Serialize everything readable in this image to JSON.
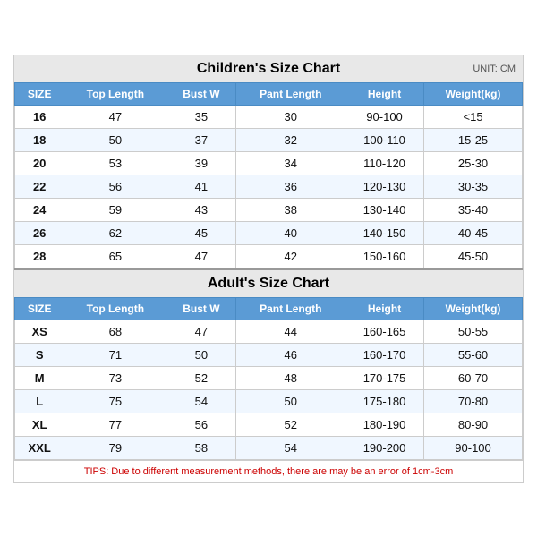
{
  "children_title": "Children's Size Chart",
  "adult_title": "Adult's Size Chart",
  "unit_label": "UNIT: CM",
  "columns": [
    "SIZE",
    "Top Length",
    "Bust W",
    "Pant Length",
    "Height",
    "Weight(kg)"
  ],
  "children_rows": [
    [
      "16",
      "47",
      "35",
      "30",
      "90-100",
      "<15"
    ],
    [
      "18",
      "50",
      "37",
      "32",
      "100-110",
      "15-25"
    ],
    [
      "20",
      "53",
      "39",
      "34",
      "110-120",
      "25-30"
    ],
    [
      "22",
      "56",
      "41",
      "36",
      "120-130",
      "30-35"
    ],
    [
      "24",
      "59",
      "43",
      "38",
      "130-140",
      "35-40"
    ],
    [
      "26",
      "62",
      "45",
      "40",
      "140-150",
      "40-45"
    ],
    [
      "28",
      "65",
      "47",
      "42",
      "150-160",
      "45-50"
    ]
  ],
  "adult_rows": [
    [
      "XS",
      "68",
      "47",
      "44",
      "160-165",
      "50-55"
    ],
    [
      "S",
      "71",
      "50",
      "46",
      "160-170",
      "55-60"
    ],
    [
      "M",
      "73",
      "52",
      "48",
      "170-175",
      "60-70"
    ],
    [
      "L",
      "75",
      "54",
      "50",
      "175-180",
      "70-80"
    ],
    [
      "XL",
      "77",
      "56",
      "52",
      "180-190",
      "80-90"
    ],
    [
      "XXL",
      "79",
      "58",
      "54",
      "190-200",
      "90-100"
    ]
  ],
  "tips": "TIPS: Due to different measurement methods, there are may be an error of 1cm-3cm"
}
